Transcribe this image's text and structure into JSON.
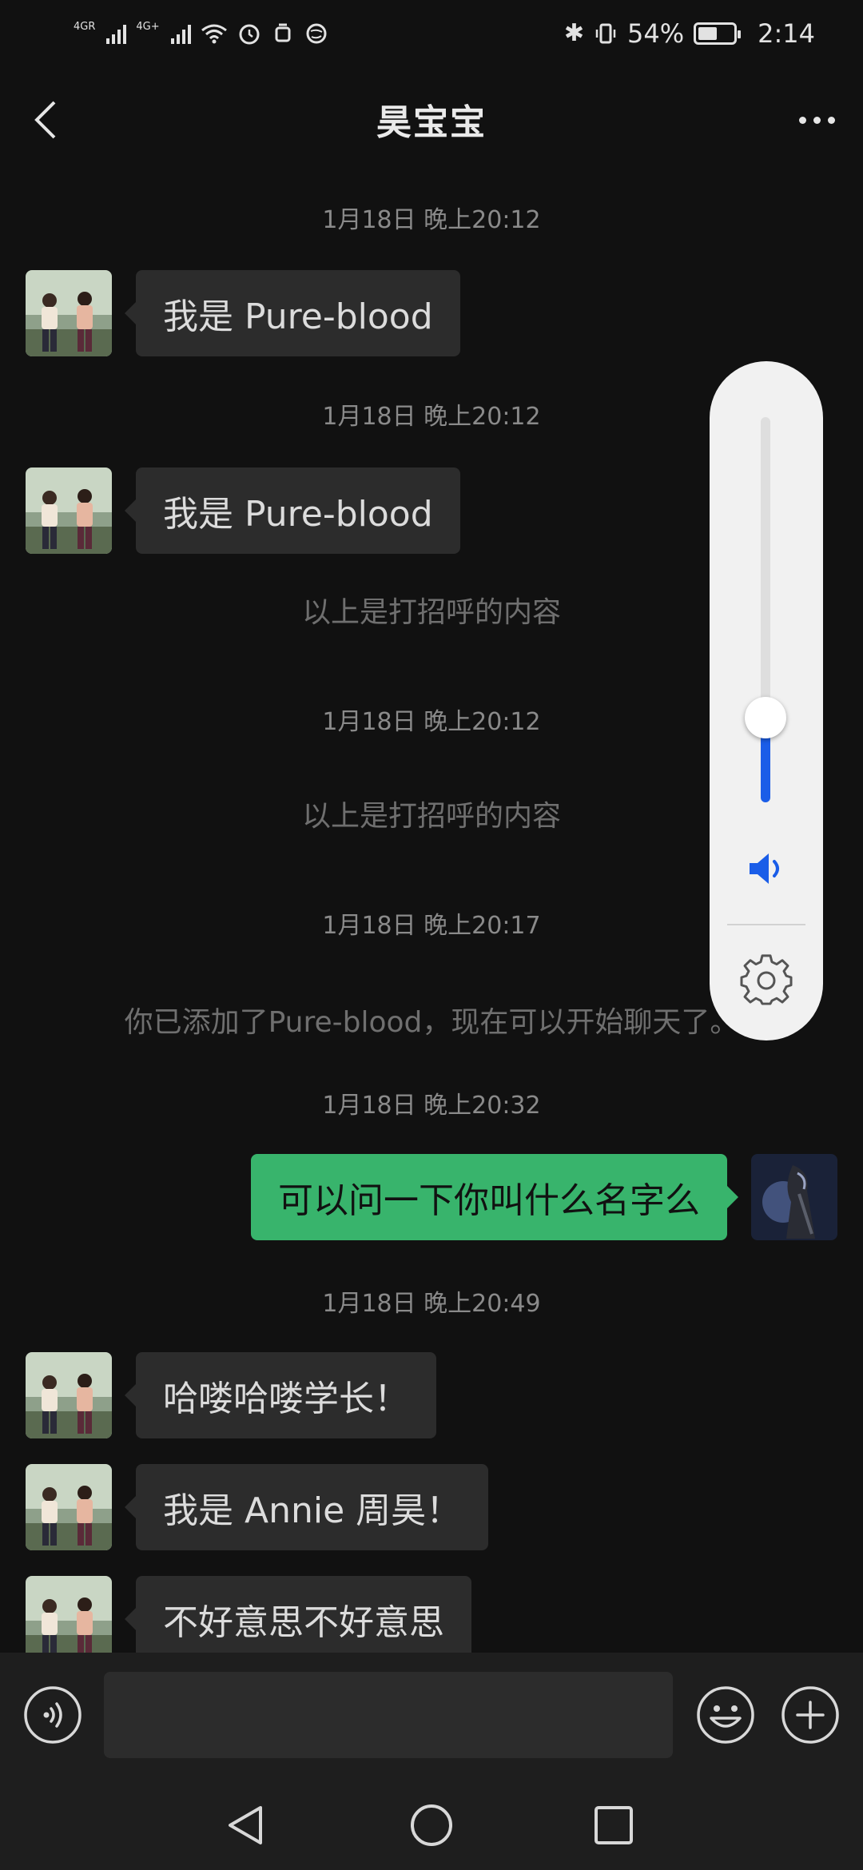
{
  "status_bar": {
    "network1": "4G",
    "network1_sup": "R",
    "network2": "4G",
    "network2_sup": "+",
    "battery": "54%",
    "time": "2:14"
  },
  "header": {
    "title": "昊宝宝"
  },
  "messages": [
    {
      "type": "timestamp",
      "text": "1月18日 晚上20:12"
    },
    {
      "type": "incoming",
      "text": "我是 Pure-blood"
    },
    {
      "type": "timestamp",
      "text": "1月18日 晚上20:12"
    },
    {
      "type": "incoming",
      "text": "我是 Pure-blood"
    },
    {
      "type": "system",
      "text": "以上是打招呼的内容"
    },
    {
      "type": "timestamp",
      "text": "1月18日 晚上20:12"
    },
    {
      "type": "system",
      "text": "以上是打招呼的内容"
    },
    {
      "type": "timestamp",
      "text": "1月18日 晚上20:17"
    },
    {
      "type": "system",
      "text": "你已添加了Pure-blood，现在可以开始聊天了。"
    },
    {
      "type": "timestamp",
      "text": "1月18日 晚上20:32"
    },
    {
      "type": "outgoing",
      "text": "可以问一下你叫什么名字么"
    },
    {
      "type": "timestamp",
      "text": "1月18日 晚上20:49"
    },
    {
      "type": "incoming",
      "text": "哈喽哈喽学长！"
    },
    {
      "type": "incoming",
      "text": "我是 Annie 周昊！"
    },
    {
      "type": "incoming",
      "text": "不好意思不好意思"
    }
  ],
  "volume": {
    "level": 0.22
  },
  "input": {
    "value": ""
  },
  "colors": {
    "background": "#111111",
    "incoming_bubble": "#2c2c2c",
    "outgoing_bubble": "#38b46c",
    "volume_accent": "#1a5de8"
  },
  "icons": {
    "back": "chevron-left-icon",
    "more": "more-dots-icon",
    "voice": "voice-icon",
    "emoji": "emoji-icon",
    "plus": "plus-icon",
    "volume": "speaker-icon",
    "settings": "gear-icon"
  }
}
